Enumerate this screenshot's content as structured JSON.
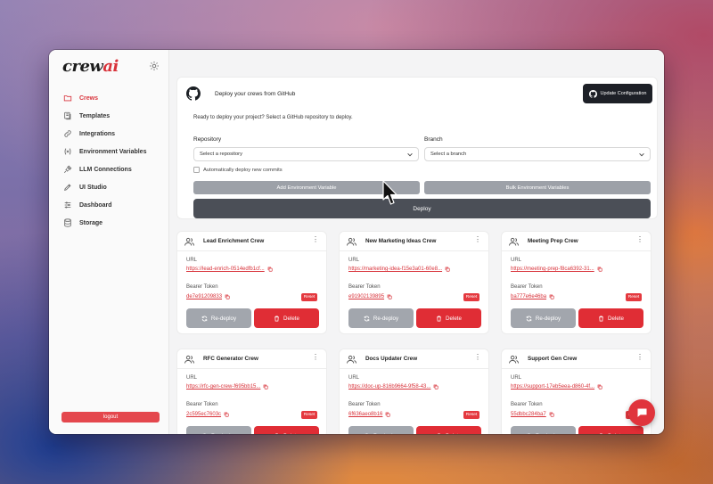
{
  "app": {
    "logo_text": "crew",
    "logo_accent": "ai",
    "brand_color": "#d8323a"
  },
  "sidebar": {
    "items": [
      {
        "label": "Crews",
        "icon": "folder-icon",
        "active": true
      },
      {
        "label": "Templates",
        "icon": "templates-icon"
      },
      {
        "label": "Integrations",
        "icon": "link-icon"
      },
      {
        "label": "Environment Variables",
        "icon": "variable-icon"
      },
      {
        "label": "LLM Connections",
        "icon": "plug-icon"
      },
      {
        "label": "UI Studio",
        "icon": "ui-studio-icon"
      },
      {
        "label": "Dashboard",
        "icon": "dashboard-icon"
      },
      {
        "label": "Storage",
        "icon": "database-icon"
      }
    ],
    "logout_label": "logout"
  },
  "deploy": {
    "title": "Deploy your crews from GitHub",
    "update_label": "Update Configuration",
    "ready_text": "Ready to deploy your project? Select a GitHub repository to deploy.",
    "repository_label": "Repository",
    "repository_placeholder": "Select a repository",
    "branch_label": "Branch",
    "branch_placeholder": "Select a branch",
    "auto_deploy_label": "Automatically deploy new commits",
    "add_env_label": "Add Environment Variable",
    "bulk_env_label": "Bulk Environment Variables",
    "deploy_label": "Deploy"
  },
  "crew_labels": {
    "url": "URL",
    "token": "Bearer Token",
    "reset": "Reset",
    "redeploy": "Re-deploy",
    "delete": "Delete"
  },
  "crews": [
    {
      "name": "Lead Enrichment Crew",
      "url": "https://lead-enrich-0514edfb1cf...",
      "token": "de7e91209833"
    },
    {
      "name": "New Marketing Ideas Crew",
      "url": "https://marketing-idea-f15e3a01-60e8...",
      "token": "e91902139895"
    },
    {
      "name": "Meeting Prep Crew",
      "url": "https://meeting-prep-f8ca6392-31...",
      "token": "ba777e6e46ba"
    },
    {
      "name": "RFC Generator Crew",
      "url": "https://rfc-gen-crew-f695bb15...",
      "token": "2c595ec7603c"
    },
    {
      "name": "Docs Updater Crew",
      "url": "https://doc-up-816b9664-9f58-43...",
      "token": "6f636aeo8b16"
    },
    {
      "name": "Support Gen Crew",
      "url": "https://support-17eb5eea-d860-4f...",
      "token": "55dbbc284ba7"
    }
  ]
}
